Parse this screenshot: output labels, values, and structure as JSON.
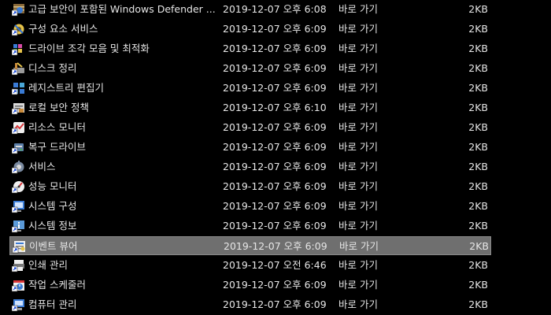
{
  "colors": {
    "background": "#000000",
    "text": "#e6e6e6",
    "selection": "#6f6f6f"
  },
  "files": [
    {
      "name": "고급 보안이 포함된 Windows Defender ...",
      "date": "2019-12-07 오후 6:08",
      "type": "바로 가기",
      "size": "2KB",
      "icon": "firewall-shortcut-icon",
      "selected": false
    },
    {
      "name": "구성 요소 서비스",
      "date": "2019-12-07 오후 6:09",
      "type": "바로 가기",
      "size": "2KB",
      "icon": "component-services-shortcut-icon",
      "selected": false
    },
    {
      "name": "드라이브 조각 모음 및 최적화",
      "date": "2019-12-07 오후 6:09",
      "type": "바로 가기",
      "size": "2KB",
      "icon": "defrag-shortcut-icon",
      "selected": false
    },
    {
      "name": "디스크 정리",
      "date": "2019-12-07 오후 6:09",
      "type": "바로 가기",
      "size": "2KB",
      "icon": "disk-cleanup-shortcut-icon",
      "selected": false
    },
    {
      "name": "레지스트리 편집기",
      "date": "2019-12-07 오후 6:09",
      "type": "바로 가기",
      "size": "2KB",
      "icon": "registry-editor-shortcut-icon",
      "selected": false
    },
    {
      "name": "로컬 보안 정책",
      "date": "2019-12-07 오후 6:10",
      "type": "바로 가기",
      "size": "2KB",
      "icon": "local-security-policy-shortcut-icon",
      "selected": false
    },
    {
      "name": "리소스 모니터",
      "date": "2019-12-07 오후 6:09",
      "type": "바로 가기",
      "size": "2KB",
      "icon": "resource-monitor-shortcut-icon",
      "selected": false
    },
    {
      "name": "복구 드라이브",
      "date": "2019-12-07 오후 6:09",
      "type": "바로 가기",
      "size": "2KB",
      "icon": "recovery-drive-shortcut-icon",
      "selected": false
    },
    {
      "name": "서비스",
      "date": "2019-12-07 오후 6:09",
      "type": "바로 가기",
      "size": "2KB",
      "icon": "services-shortcut-icon",
      "selected": false
    },
    {
      "name": "성능 모니터",
      "date": "2019-12-07 오후 6:09",
      "type": "바로 가기",
      "size": "2KB",
      "icon": "performance-monitor-shortcut-icon",
      "selected": false
    },
    {
      "name": "시스템 구성",
      "date": "2019-12-07 오후 6:09",
      "type": "바로 가기",
      "size": "2KB",
      "icon": "system-configuration-shortcut-icon",
      "selected": false
    },
    {
      "name": "시스템 정보",
      "date": "2019-12-07 오후 6:09",
      "type": "바로 가기",
      "size": "2KB",
      "icon": "system-information-shortcut-icon",
      "selected": false
    },
    {
      "name": "이벤트 뷰어",
      "date": "2019-12-07 오후 6:09",
      "type": "바로 가기",
      "size": "2KB",
      "icon": "event-viewer-shortcut-icon",
      "selected": true
    },
    {
      "name": "인쇄 관리",
      "date": "2019-12-07 오전 6:46",
      "type": "바로 가기",
      "size": "2KB",
      "icon": "print-management-shortcut-icon",
      "selected": false
    },
    {
      "name": "작업 스케줄러",
      "date": "2019-12-07 오후 6:09",
      "type": "바로 가기",
      "size": "2KB",
      "icon": "task-scheduler-shortcut-icon",
      "selected": false
    },
    {
      "name": "컴퓨터 관리",
      "date": "2019-12-07 오후 6:09",
      "type": "바로 가기",
      "size": "2KB",
      "icon": "computer-management-shortcut-icon",
      "selected": false
    }
  ]
}
